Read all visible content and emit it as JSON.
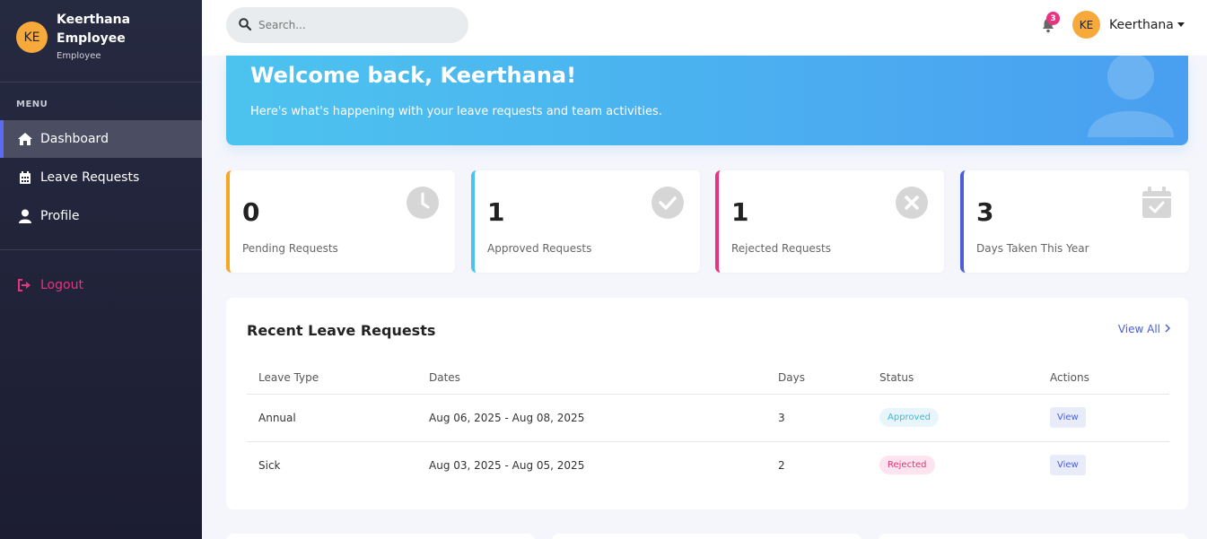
{
  "sidebar": {
    "user": {
      "initials": "KE",
      "name": "Keerthana Employee",
      "role": "Employee"
    },
    "menu_title": "MENU",
    "items": [
      {
        "label": "Dashboard",
        "icon": "home-icon",
        "active": true
      },
      {
        "label": "Leave Requests",
        "icon": "calendar-icon",
        "active": false
      },
      {
        "label": "Profile",
        "icon": "user-icon",
        "active": false
      }
    ],
    "logout_label": "Logout"
  },
  "header": {
    "search_placeholder": "Search...",
    "notification_count": "3",
    "user_initials": "KE",
    "user_name": "Keerthana"
  },
  "welcome": {
    "title": "Welcome back, Keerthana!",
    "subtitle": "Here's what's happening with your leave requests and team activities."
  },
  "stats": [
    {
      "value": "0",
      "label": "Pending Requests",
      "icon": "clock-icon",
      "color": "#f5a623"
    },
    {
      "value": "1",
      "label": "Approved Requests",
      "icon": "check-circle-icon",
      "color": "#4cc3ef"
    },
    {
      "value": "1",
      "label": "Rejected Requests",
      "icon": "x-circle-icon",
      "color": "#e8337f"
    },
    {
      "value": "3",
      "label": "Days Taken This Year",
      "icon": "calendar-check-icon",
      "color": "#4a5fd8"
    }
  ],
  "recent": {
    "title": "Recent Leave Requests",
    "view_all": "View All",
    "columns": [
      "Leave Type",
      "Dates",
      "Days",
      "Status",
      "Actions"
    ],
    "rows": [
      {
        "type": "Annual",
        "dates": "Aug 06, 2025 - Aug 08, 2025",
        "days": "3",
        "status": "Approved",
        "action": "View"
      },
      {
        "type": "Sick",
        "dates": "Aug 03, 2025 - Aug 05, 2025",
        "days": "2",
        "status": "Rejected",
        "action": "View"
      }
    ]
  },
  "colors": {
    "accent": "#4a5fd8",
    "sidebar": "#262a40",
    "approved": "#4cc3ef",
    "rejected": "#e8337f",
    "pending": "#f5a623"
  }
}
